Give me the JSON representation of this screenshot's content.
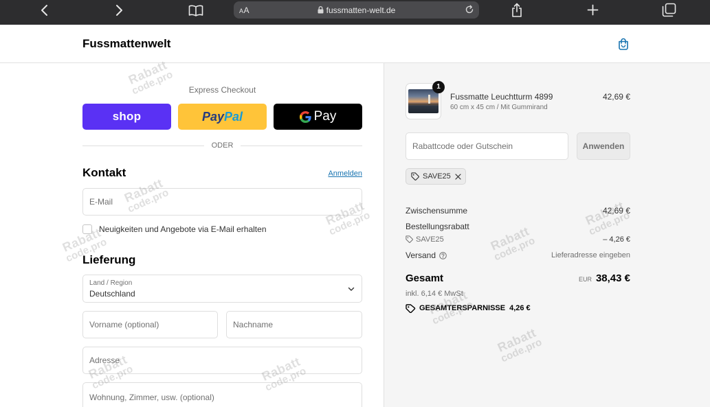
{
  "browser": {
    "text_size_button": "AA",
    "url": "fussmatten-welt.de"
  },
  "header": {
    "store_name": "Fussmattenwelt"
  },
  "checkout": {
    "express_title": "Express Checkout",
    "shop_pay_label": "shop",
    "paypal_pay": "Pay",
    "paypal_pal": "Pal",
    "gpay_label": "Pay",
    "divider_label": "ODER",
    "contact": {
      "heading": "Kontakt",
      "login_link": "Anmelden",
      "email_placeholder": "E-Mail",
      "newsletter_label": "Neuigkeiten und Angebote via E-Mail erhalten",
      "newsletter_checked": false
    },
    "delivery": {
      "heading": "Lieferung",
      "country_label": "Land / Region",
      "country_value": "Deutschland",
      "first_name_placeholder": "Vorname (optional)",
      "last_name_placeholder": "Nachname",
      "address_placeholder": "Adresse",
      "apartment_placeholder": "Wohnung, Zimmer, usw. (optional)"
    }
  },
  "order_summary": {
    "items": [
      {
        "name": "Fussmatte Leuchtturm 4899",
        "variant": "60 cm x 45 cm / Mit Gummirand",
        "quantity": "1",
        "price": "42,69 €"
      }
    ],
    "discount_placeholder": "Rabattcode oder Gutschein",
    "apply_button": "Anwenden",
    "applied_code": "SAVE25",
    "subtotal_label": "Zwischensumme",
    "subtotal_value": "42,69 €",
    "order_discount_label": "Bestellungsrabatt",
    "discount_code": "SAVE25",
    "discount_value": "– 4,26 €",
    "shipping_label": "Versand",
    "shipping_value": "Lieferadresse eingeben",
    "total_label": "Gesamt",
    "currency": "EUR",
    "total_value": "38,43 €",
    "tax_note": "inkl. 6,14 € MwSt",
    "total_savings_label": "GESAMTERSPARNISSE",
    "total_savings_value": "4,26 €"
  },
  "watermark": {
    "line1": "Rabatt",
    "line2": "code.pro"
  },
  "colors": {
    "browser_chrome": "#2d2d2f",
    "accent_link": "#1773b0",
    "shop_pay": "#5a31f4",
    "paypal": "#ffc439",
    "gpay": "#000000",
    "sidebar_background": "#f5f5f5",
    "muted_text": "#707070"
  },
  "icons": {
    "back": "chevron-left-icon",
    "forward": "chevron-right-icon",
    "bookmarks": "book-icon",
    "secure": "lock-icon",
    "reload": "reload-icon",
    "share": "share-icon",
    "new_tab": "plus-icon",
    "tabs": "tabs-icon",
    "cart": "shopping-bag-icon",
    "google": "google-g-icon",
    "select": "chevron-down-icon",
    "discount": "tag-icon",
    "remove": "close-icon",
    "help": "question-circle-icon",
    "savings": "savings-tag-icon"
  }
}
